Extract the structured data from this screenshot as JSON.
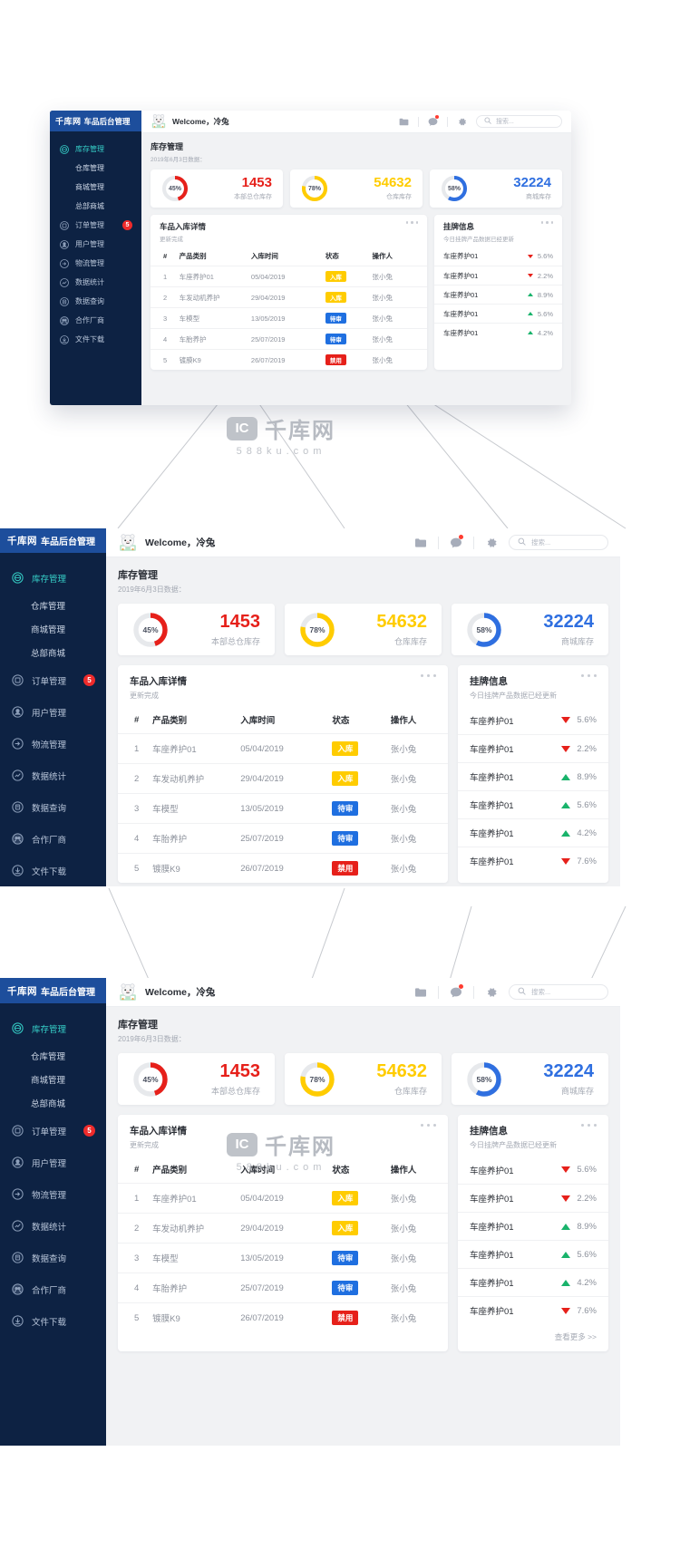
{
  "brand": {
    "logo": "千库网",
    "title": "车品后台管理"
  },
  "topbar": {
    "welcome": "Welcome，冷兔",
    "icons": [
      "folder-icon",
      "chat-icon",
      "gear-icon"
    ],
    "search_placeholder": "搜索..."
  },
  "sidebar": {
    "items": [
      {
        "label": "库存管理",
        "icon": "inventory-icon",
        "active": true,
        "sub": false,
        "badge": ""
      },
      {
        "label": "仓库管理",
        "icon": "",
        "active": false,
        "sub": true,
        "badge": ""
      },
      {
        "label": "商城管理",
        "icon": "",
        "active": false,
        "sub": true,
        "badge": ""
      },
      {
        "label": "总部商城",
        "icon": "",
        "active": false,
        "sub": true,
        "badge": ""
      },
      {
        "label": "订单管理",
        "icon": "order-icon",
        "active": false,
        "sub": false,
        "badge": "5"
      },
      {
        "label": "用户管理",
        "icon": "user-icon",
        "active": false,
        "sub": false,
        "badge": ""
      },
      {
        "label": "物流管理",
        "icon": "logistics-icon",
        "active": false,
        "sub": false,
        "badge": ""
      },
      {
        "label": "数据统计",
        "icon": "chart-icon",
        "active": false,
        "sub": false,
        "badge": ""
      },
      {
        "label": "数据查询",
        "icon": "database-icon",
        "active": false,
        "sub": false,
        "badge": ""
      },
      {
        "label": "合作厂商",
        "icon": "partners-icon",
        "active": false,
        "sub": false,
        "badge": ""
      },
      {
        "label": "文件下载",
        "icon": "download-icon",
        "active": false,
        "sub": false,
        "badge": ""
      }
    ]
  },
  "page": {
    "title": "库存管理",
    "subtitle": "2019年6月3日数据："
  },
  "stat_cards": [
    {
      "percent": "45%",
      "percent_value": 45,
      "value": "1453",
      "label": "本部总仓库存",
      "color": "#e6201a"
    },
    {
      "percent": "78%",
      "percent_value": 78,
      "value": "54632",
      "label": "仓库库存",
      "color": "#ffcc00"
    },
    {
      "percent": "58%",
      "percent_value": 58,
      "value": "32224",
      "label": "商城库存",
      "color": "#2f6fe0"
    }
  ],
  "table_panel": {
    "title": "车品入库详情",
    "subtitle": "更新完成",
    "menu_icon": "more-dots-icon",
    "columns": [
      "#",
      "产品类别",
      "入库时间",
      "状态",
      "操作人"
    ],
    "rows": [
      {
        "idx": "1",
        "category": "车座养护01",
        "time": "05/04/2019",
        "status": "入库",
        "status_type": "in",
        "operator": "张小兔"
      },
      {
        "idx": "2",
        "category": "车发动机养护",
        "time": "29/04/2019",
        "status": "入库",
        "status_type": "in",
        "operator": "张小兔"
      },
      {
        "idx": "3",
        "category": "车模型",
        "time": "13/05/2019",
        "status": "待审",
        "status_type": "pending",
        "operator": "张小兔"
      },
      {
        "idx": "4",
        "category": "车胎养护",
        "time": "25/07/2019",
        "status": "待审",
        "status_type": "pending",
        "operator": "张小兔"
      },
      {
        "idx": "5",
        "category": "镀膜K9",
        "time": "26/07/2019",
        "status": "禁用",
        "status_type": "ban",
        "operator": "张小兔"
      }
    ]
  },
  "listing_panel": {
    "title": "挂牌信息",
    "subtitle": "今日挂牌产品数据已经更新",
    "menu_icon": "more-dots-icon",
    "more_label": "查看更多 >>",
    "rows": [
      {
        "name": "车座养护01",
        "pct": "5.6%",
        "dir": "down"
      },
      {
        "name": "车座养护01",
        "pct": "2.2%",
        "dir": "down"
      },
      {
        "name": "车座养护01",
        "pct": "8.9%",
        "dir": "up"
      },
      {
        "name": "车座养护01",
        "pct": "5.6%",
        "dir": "up"
      },
      {
        "name": "车座养护01",
        "pct": "4.2%",
        "dir": "up"
      },
      {
        "name": "车座养护01",
        "pct": "7.6%",
        "dir": "down"
      }
    ]
  },
  "watermark": {
    "badge": "IC",
    "text": "千库网",
    "sub": "588ku.com"
  },
  "colors": {
    "sidebar_bg": "#0d2243",
    "brand_bg": "#1d4e9c",
    "active": "#36d0c8",
    "red": "#e6201a",
    "yellow": "#ffcc00",
    "blue": "#2f6fe0",
    "green": "#19b36b",
    "page_bg": "#f1f2f4"
  }
}
